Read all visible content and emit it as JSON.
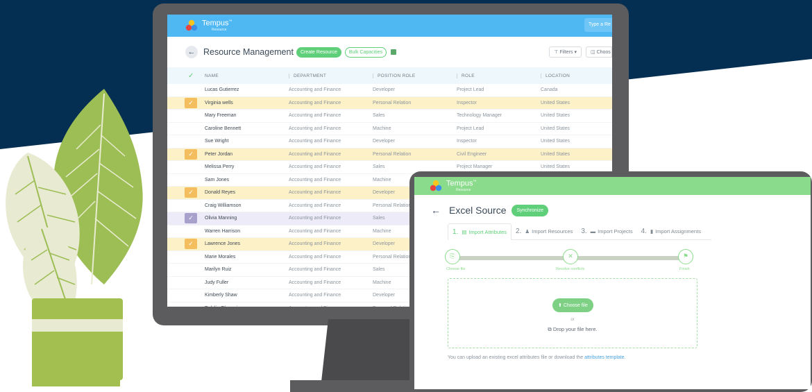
{
  "colors": {
    "navy": "#042f52",
    "accent_blue": "#4fb8f3",
    "accent_green": "#5fcf7a",
    "selected_row": "#fdf1c8"
  },
  "monitor": {
    "app": {
      "name": "Tempus",
      "trademark": "™",
      "sub": "Resource",
      "search_placeholder": "Type a Re"
    },
    "header": {
      "title": "Resource Management",
      "create_label": "Create Resource",
      "bulk_label": "Bulk Capacities",
      "filters_label": "Filters",
      "choose_label": "Choos"
    },
    "columns": [
      "NAME",
      "DEPARTMENT",
      "POSITION ROLE",
      "ROLE",
      "LOCATION"
    ],
    "rows": [
      {
        "name": "Lucas Gutierrez",
        "dept": "Accounting and Finance",
        "pos": "Developer",
        "role": "Project Lead",
        "loc": "Canada",
        "sel": ""
      },
      {
        "name": "Virginia wells",
        "dept": "Accounting and Finance",
        "pos": "Personal Relation",
        "role": "Inspector",
        "loc": "United States",
        "sel": "sel"
      },
      {
        "name": "Mary Freeman",
        "dept": "Accounting and Finance",
        "pos": "Sales",
        "role": "Technology Manager",
        "loc": "United States",
        "sel": ""
      },
      {
        "name": "Caroline Bennett",
        "dept": "Accounting and Finance",
        "pos": "Machine",
        "role": "Project Lead",
        "loc": "United States",
        "sel": ""
      },
      {
        "name": "Sue Wright",
        "dept": "Accounting and Finance",
        "pos": "Developer",
        "role": "Inspector",
        "loc": "United States",
        "sel": ""
      },
      {
        "name": "Peter Jordan",
        "dept": "Accounting and Finance",
        "pos": "Personal Relation",
        "role": "Civil Engineer",
        "loc": "United States",
        "sel": "sel"
      },
      {
        "name": "Melissa Perry",
        "dept": "Accounting and Finance",
        "pos": "Sales",
        "role": "Project Manager",
        "loc": "United States",
        "sel": ""
      },
      {
        "name": "Sam Jones",
        "dept": "Accounting and Finance",
        "pos": "Machine",
        "role": "",
        "loc": "",
        "sel": ""
      },
      {
        "name": "Donald Reyes",
        "dept": "Accounting and Finance",
        "pos": "Developer",
        "role": "",
        "loc": "",
        "sel": "sel"
      },
      {
        "name": "Craig Williamson",
        "dept": "Accounting and Finance",
        "pos": "Personal Relation",
        "role": "",
        "loc": "",
        "sel": ""
      },
      {
        "name": "Olivia Manning",
        "dept": "Accounting and Finance",
        "pos": "Sales",
        "role": "",
        "loc": "",
        "sel": "sel2"
      },
      {
        "name": "Warren Harrison",
        "dept": "Accounting and Finance",
        "pos": "Machine",
        "role": "",
        "loc": "",
        "sel": ""
      },
      {
        "name": "Lawrence Jones",
        "dept": "Accounting and Finance",
        "pos": "Developer",
        "role": "",
        "loc": "",
        "sel": "sel"
      },
      {
        "name": "Marie Morales",
        "dept": "Accounting and Finance",
        "pos": "Personal Relation",
        "role": "",
        "loc": "",
        "sel": ""
      },
      {
        "name": "Marilyn Ruiz",
        "dept": "Accounting and Finance",
        "pos": "Sales",
        "role": "",
        "loc": "",
        "sel": ""
      },
      {
        "name": "Judy Fuller",
        "dept": "Accounting and Finance",
        "pos": "Machine",
        "role": "",
        "loc": "",
        "sel": ""
      },
      {
        "name": "Kimberly Shaw",
        "dept": "Accounting and Finance",
        "pos": "Developer",
        "role": "",
        "loc": "",
        "sel": ""
      },
      {
        "name": "Eulalia Olavarria",
        "dept": "Accounting and Finance",
        "pos": "Personal Relation",
        "role": "",
        "loc": "",
        "sel": ""
      }
    ]
  },
  "tablet": {
    "app": {
      "name": "Tempus",
      "trademark": "™",
      "sub": "Resource"
    },
    "title": "Excel Source",
    "sync_label": "Synchronize",
    "steps": [
      {
        "num": "1.",
        "label": "Import Attributes",
        "icon": "list-icon"
      },
      {
        "num": "2.",
        "label": "Import Resources",
        "icon": "user-icon"
      },
      {
        "num": "3.",
        "label": "Import Projects",
        "icon": "folder-icon"
      },
      {
        "num": "4.",
        "label": "Import Assignments",
        "icon": "file-icon"
      }
    ],
    "progress": [
      "Choose file",
      "Resolve conflicts",
      "Finish"
    ],
    "choose_file_label": "Choose file",
    "or_label": "or",
    "drop_label": "Drop your file here.",
    "hint_text": "You can upload an existing excel attributes file or download the",
    "hint_link": "attributes template",
    "hint_end": "."
  }
}
